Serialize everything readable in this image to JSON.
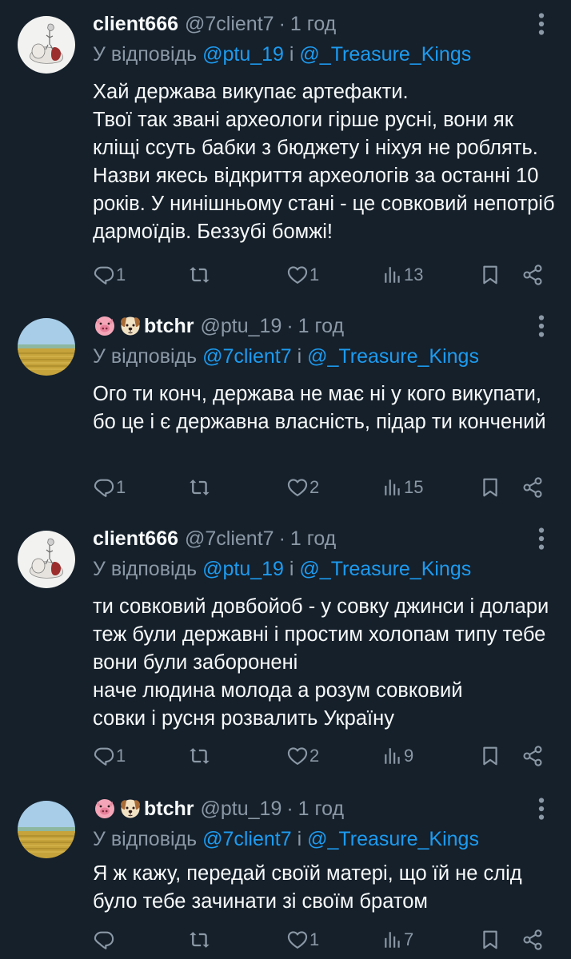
{
  "tweets": [
    {
      "display_name": "client666",
      "handle": "@7client7",
      "separator": "·",
      "time": "1 год",
      "reply_prefix": "У відповідь",
      "reply_mention_1": "@ptu_19",
      "reply_and": "і",
      "reply_mention_2": "@_Treasure_Kings",
      "body": "Хай держава викупає артефакти.\nТвої так звані археологи гірше русні, вони як кліщі ссуть бабки з бюджету і ніхуя не роблять. Назви якесь відкриття археологів за останні 10 років. У нинішньому стані - це совковий непотріб дармоїдів. Беззубі бомжі!",
      "replies": "1",
      "reposts": "",
      "likes": "1",
      "views": "13",
      "avatar_icon": "sketch-figure-avatar",
      "name_emojis": []
    },
    {
      "display_name": "btchr",
      "handle": "@ptu_19",
      "separator": "·",
      "time": "1 год",
      "reply_prefix": "У відповідь",
      "reply_mention_1": "@7client7",
      "reply_and": "і",
      "reply_mention_2": "@_Treasure_Kings",
      "body": "Ого ти конч, держава не має ні у кого викупати, бо це і є державна власність, підар ти кончений",
      "replies": "1",
      "reposts": "",
      "likes": "2",
      "views": "15",
      "avatar_icon": "field-landscape-avatar",
      "name_emojis": [
        "pig-face-emoji",
        "dog-face-emoji"
      ]
    },
    {
      "display_name": "client666",
      "handle": "@7client7",
      "separator": "·",
      "time": "1 год",
      "reply_prefix": "У відповідь",
      "reply_mention_1": "@ptu_19",
      "reply_and": "і",
      "reply_mention_2": "@_Treasure_Kings",
      "body": "ти совковий довбойоб - у совку джинси і долари теж були державні і простим холопам типу тебе вони були заборонені\nначе людина молода а розум совковий\nсовки і русня розвалить Україну",
      "replies": "1",
      "reposts": "",
      "likes": "2",
      "views": "9",
      "avatar_icon": "sketch-figure-avatar",
      "name_emojis": []
    },
    {
      "display_name": "btchr",
      "handle": "@ptu_19",
      "separator": "·",
      "time": "1 год",
      "reply_prefix": "У відповідь",
      "reply_mention_1": "@7client7",
      "reply_and": "і",
      "reply_mention_2": "@_Treasure_Kings",
      "body": "Я ж кажу, передай своїй матері, що їй не слід було тебе зачинати зі своїм братом",
      "replies": "",
      "reposts": "",
      "likes": "1",
      "views": "7",
      "avatar_icon": "field-landscape-avatar",
      "name_emojis": [
        "pig-face-emoji",
        "dog-face-emoji"
      ]
    }
  ],
  "colors": {
    "background": "#15202b",
    "text_primary": "#f7f9f9",
    "text_secondary": "#8b98a5",
    "accent": "#1d9bf0"
  }
}
